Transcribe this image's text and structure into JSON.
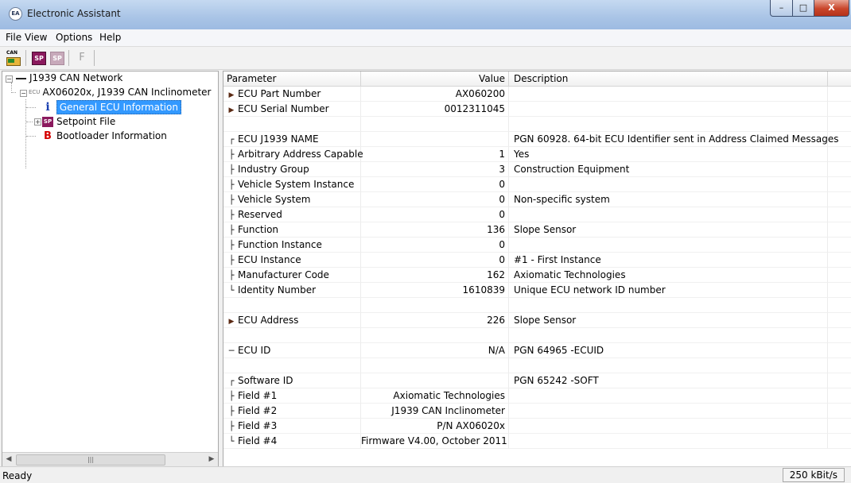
{
  "window": {
    "title": "Electronic Assistant",
    "icon": "EA",
    "min_label": "–",
    "max_label": "□",
    "close_label": "X"
  },
  "menu": [
    "File",
    "View",
    "Options",
    "Help"
  ],
  "toolbar": {
    "can_icon": "CAN",
    "sp1_icon": "SP",
    "sp2_icon": "SP",
    "f_label": "F"
  },
  "tree": {
    "root": "J1939 CAN Network",
    "ecu_prefix": "ECU",
    "ecu": "AX06020x, J1939 CAN Inclinometer",
    "general": "General ECU Information",
    "setpoint_prefix": "SP",
    "setpoint": "Setpoint File",
    "boot_prefix": "B",
    "bootloader": "Bootloader Information",
    "general_icon": "i"
  },
  "grid": {
    "headers": {
      "param": "Parameter",
      "value": "Value",
      "desc": "Description"
    },
    "rows": [
      {
        "icon": "bullet",
        "param": "ECU Part Number",
        "value": "AX060200",
        "desc": ""
      },
      {
        "icon": "bullet",
        "param": "ECU Serial Number",
        "value": "0012311045",
        "desc": ""
      },
      {
        "icon": "",
        "param": "",
        "value": "",
        "desc": ""
      },
      {
        "icon": "group-start",
        "param": "ECU J1939 NAME",
        "value": "",
        "desc": "PGN 60928. 64-bit ECU Identifier sent in Address Claimed Messages"
      },
      {
        "icon": "branch",
        "param": "Arbitrary Address Capable",
        "value": "1",
        "desc": "Yes"
      },
      {
        "icon": "branch",
        "param": "Industry Group",
        "value": "3",
        "desc": "Construction Equipment"
      },
      {
        "icon": "branch",
        "param": "Vehicle System Instance",
        "value": "0",
        "desc": ""
      },
      {
        "icon": "branch",
        "param": "Vehicle System",
        "value": "0",
        "desc": "Non-specific system"
      },
      {
        "icon": "branch",
        "param": "Reserved",
        "value": "0",
        "desc": ""
      },
      {
        "icon": "branch",
        "param": "Function",
        "value": "136",
        "desc": "Slope Sensor"
      },
      {
        "icon": "branch",
        "param": "Function Instance",
        "value": "0",
        "desc": ""
      },
      {
        "icon": "branch",
        "param": "ECU Instance",
        "value": "0",
        "desc": "#1 - First Instance"
      },
      {
        "icon": "branch",
        "param": "Manufacturer Code",
        "value": "162",
        "desc": "Axiomatic Technologies"
      },
      {
        "icon": "branch-end",
        "param": "Identity Number",
        "value": "1610839",
        "desc": "Unique ECU network ID number"
      },
      {
        "icon": "",
        "param": "",
        "value": "",
        "desc": ""
      },
      {
        "icon": "bullet",
        "param": "ECU Address",
        "value": "226",
        "desc": "Slope Sensor"
      },
      {
        "icon": "",
        "param": "",
        "value": "",
        "desc": ""
      },
      {
        "icon": "dash",
        "param": "ECU ID",
        "value": "N/A",
        "desc": "PGN 64965   -ECUID"
      },
      {
        "icon": "",
        "param": "",
        "value": "",
        "desc": ""
      },
      {
        "icon": "group-start",
        "param": "Software ID",
        "value": "",
        "desc": "PGN 65242   -SOFT"
      },
      {
        "icon": "branch",
        "param": "Field #1",
        "value": "Axiomatic Technologies",
        "desc": ""
      },
      {
        "icon": "branch",
        "param": "Field #2",
        "value": "J1939 CAN Inclinometer",
        "desc": ""
      },
      {
        "icon": "branch",
        "param": "Field #3",
        "value": "P/N AX06020x",
        "desc": ""
      },
      {
        "icon": "branch-end",
        "param": "Field #4",
        "value": "Firmware V4.00, October 2011",
        "desc": ""
      }
    ]
  },
  "status": {
    "text": "Ready",
    "rate": "250 kBit/s"
  },
  "colors": {
    "selection": "#3399ff",
    "title_gradient": "#a9c4e6",
    "setpoint_icon": "#8b1a5e",
    "boot_letter": "#d40000",
    "info_icon": "#1a3fb0"
  }
}
